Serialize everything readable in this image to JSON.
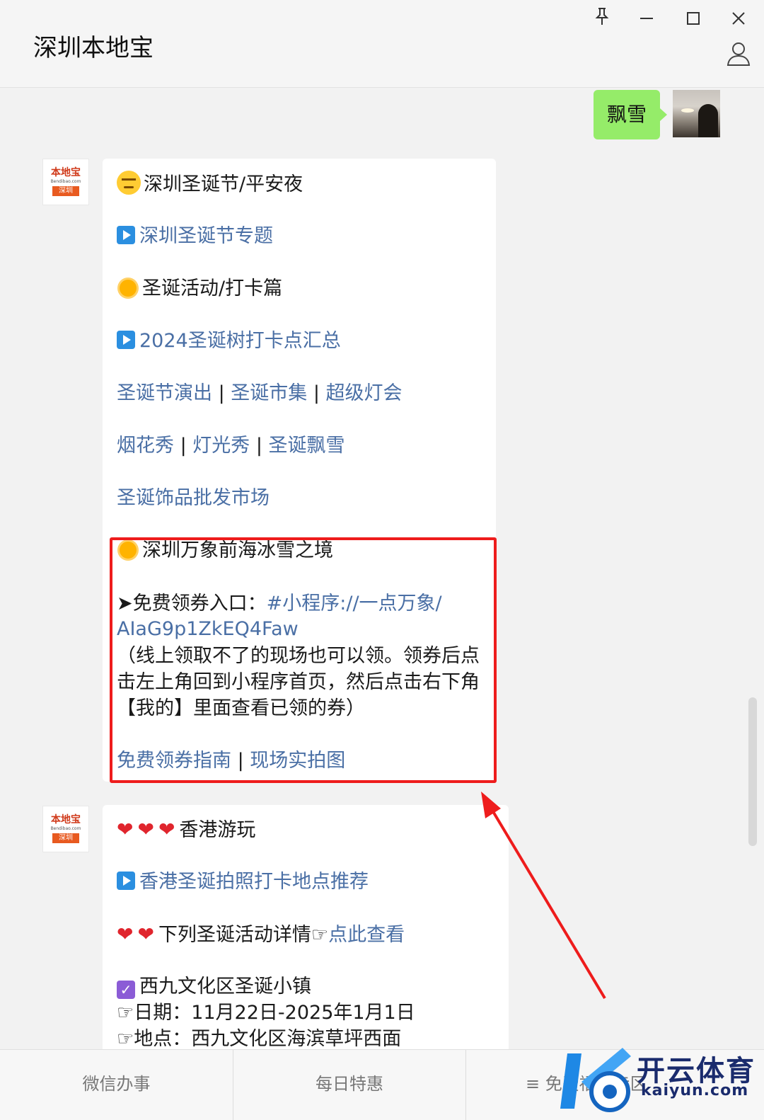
{
  "window": {
    "title": "深圳本地宝"
  },
  "my_message": {
    "text": "飘雪"
  },
  "bot": {
    "avatar_brand": "本地宝",
    "avatar_domain": "Bendibao.com",
    "avatar_city": "深圳"
  },
  "card1": {
    "heading": "深圳圣诞节/平安夜",
    "link1": "深圳圣诞节专题",
    "section1": "圣诞活动/打卡篇",
    "link2": "2024圣诞树打卡点汇总",
    "row1": [
      "圣诞节演出",
      "圣诞市集",
      "超级灯会"
    ],
    "row2": [
      "烟花秀",
      "灯光秀",
      "圣诞飘雪"
    ],
    "link3": "圣诞饰品批发市场",
    "section2": "深圳万象前海冰雪之境",
    "coupon_label": "➤免费领券入口：",
    "coupon_link_a": "#小程序://一点万象/",
    "coupon_link_b": "AIaG9p1ZkEQ4Faw",
    "note": "（线上领取不了的现场也可以领。领券后点击左上角回到小程序首页，然后点击右下角【我的】里面查看已领的券）",
    "footer_links": [
      "免费领券指南",
      "现场实拍图"
    ]
  },
  "card2": {
    "heading": "香港游玩",
    "link1": "香港圣诞拍照打卡地点推荐",
    "detail_text": "下列圣诞活动详情☞",
    "detail_link": "点此查看",
    "event_title": "西九文化区圣诞小镇",
    "event_date": "☞日期：11月22日-2025年1月1日",
    "event_place": "☞地点：西九文化区海滨草坪西面"
  },
  "bottom_tabs": [
    "微信办事",
    "每日特惠",
    "免费福利专区"
  ],
  "watermark": {
    "cn": "开云体育",
    "en": "kaiyun.com"
  },
  "colors": {
    "link": "#4a6fa5",
    "highlight": "#ee1c1c",
    "my_bubble": "#95ec69"
  }
}
